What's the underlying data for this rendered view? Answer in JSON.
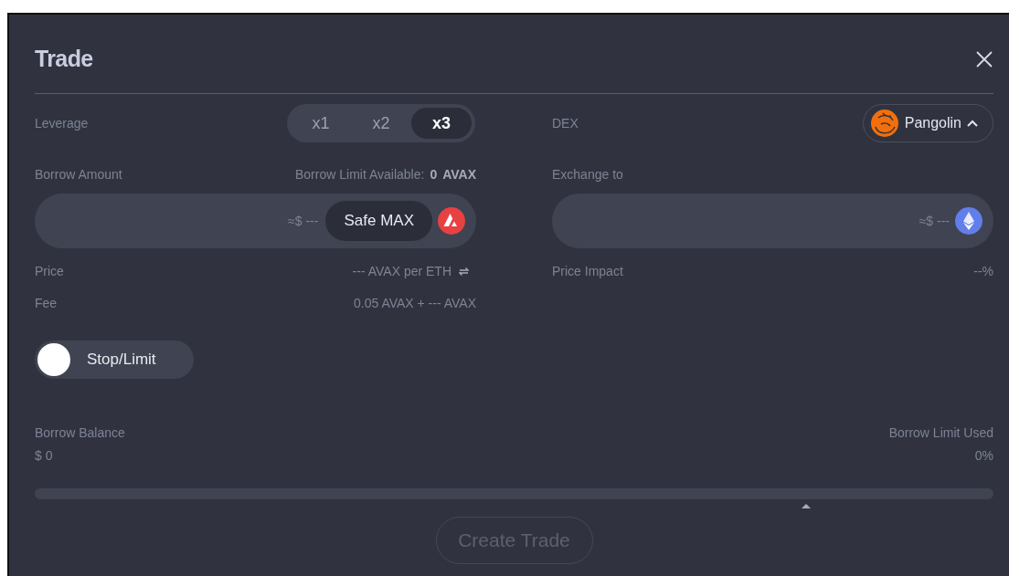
{
  "dialog": {
    "title": "Trade"
  },
  "leverage": {
    "label": "Leverage",
    "options": [
      {
        "label": "x1",
        "selected": false
      },
      {
        "label": "x2",
        "selected": false
      },
      {
        "label": "x3",
        "selected": true
      }
    ]
  },
  "dex": {
    "label": "DEX",
    "value": "Pangolin",
    "expanded": true
  },
  "borrow": {
    "label": "Borrow Amount",
    "limit_label": "Borrow Limit Available:",
    "limit_value": "0",
    "limit_unit": "AVAX",
    "usd": "≈$ ---",
    "max_button": "Safe MAX"
  },
  "exchange": {
    "label": "Exchange to",
    "usd": "≈$ ---"
  },
  "price": {
    "label": "Price",
    "value": "--- AVAX per ETH"
  },
  "price_impact": {
    "label": "Price Impact",
    "value": "--%"
  },
  "fee": {
    "label": "Fee",
    "value": "0.05 AVAX + --- AVAX"
  },
  "stop_limit": {
    "label": "Stop/Limit",
    "on": false
  },
  "borrow_balance": {
    "label": "Borrow Balance",
    "value": "$ 0"
  },
  "borrow_limit_used": {
    "label": "Borrow Limit Used",
    "value": "0%",
    "level": 0
  },
  "create_button": {
    "label": "Create Trade",
    "disabled": true
  }
}
